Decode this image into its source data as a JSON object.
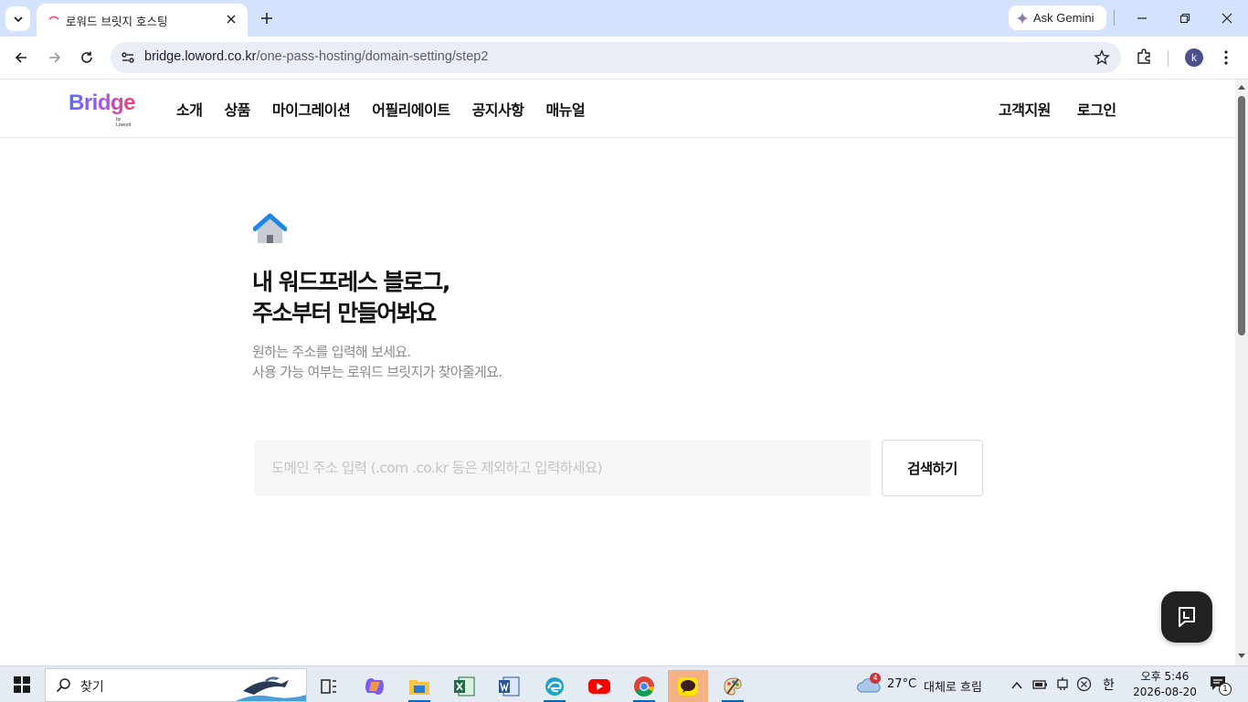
{
  "browser": {
    "tab_title": "로워드 브릿지 호스팅",
    "gemini_label": "Ask Gemini",
    "url_host": "bridge.loword.co.kr",
    "url_path": "/one-pass-hosting/domain-setting/step2",
    "profile_initial": "k"
  },
  "site": {
    "logo_text": "Bridge",
    "logo_sub": "by Loword",
    "nav": [
      "소개",
      "상품",
      "마이그레이션",
      "어필리에이트",
      "공지사항",
      "매뉴얼"
    ],
    "nav_right": [
      "고객지원",
      "로그인"
    ]
  },
  "main": {
    "headline_line1": "내 워드프레스 블로그,",
    "headline_line2": "주소부터 만들어봐요",
    "sub_line1": "원하는 주소를 입력해 보세요.",
    "sub_line2": "사용 가능 여부는 로워드 브릿지가 찾아줄게요.",
    "search_placeholder": "도메인 주소 입력 (.com .co.kr 등은 제외하고 입력하세요)",
    "search_value": "",
    "search_button": "검색하기"
  },
  "taskbar": {
    "search_label": "찾기",
    "weather_temp": "27°C",
    "weather_text": "대체로 흐림",
    "weather_badge": "4",
    "ime": "한",
    "time": "오후 5:46",
    "date": "2026-08-20",
    "notif_count": "1"
  },
  "colors": {
    "tab_strip": "#d3e3fd",
    "brand_gradient_start": "#5b6cff",
    "brand_gradient_end": "#ff3d6e",
    "home_icon_blue": "#1e88e5"
  }
}
